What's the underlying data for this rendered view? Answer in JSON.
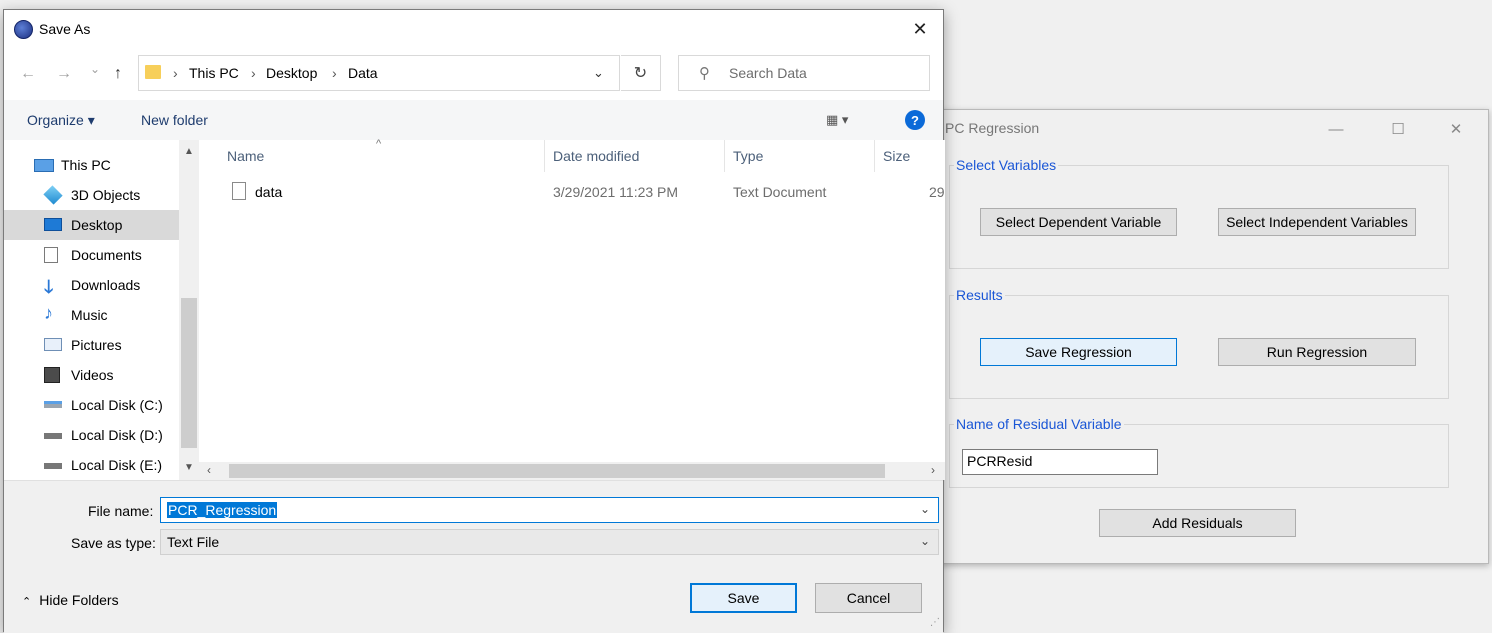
{
  "pcr_window": {
    "title": "PC Regression",
    "controls": {
      "minimize": "—",
      "maximize": "☐",
      "close": "✕"
    },
    "groups": {
      "select_variables": {
        "label": "Select Variables",
        "dependent_button": "Select Dependent Variable",
        "independent_button": "Select Independent Variables"
      },
      "results": {
        "label": "Results",
        "save_button": "Save Regression",
        "run_button": "Run Regression"
      },
      "residual": {
        "label": "Name of Residual Variable",
        "value": "PCRResid"
      }
    },
    "add_residuals_button": "Add Residuals"
  },
  "dialog": {
    "title": "Save As",
    "close": "✕",
    "nav": {
      "back": "←",
      "forward": "→",
      "recent": "⌄",
      "up": "↑"
    },
    "breadcrumb": [
      "This PC",
      "Desktop",
      "Data"
    ],
    "breadcrumb_sep": "›",
    "address_dropdown": "⌄",
    "refresh": "↻",
    "search_placeholder": "Search Data",
    "search_icon": "⚲",
    "commands": {
      "organize": "Organize ▾",
      "new_folder": "New folder",
      "view": "▦ ▾",
      "help": "?"
    },
    "nav_pane": [
      {
        "label": "This PC",
        "icon": "computer-icon"
      },
      {
        "label": "3D Objects",
        "icon": "cube-icon"
      },
      {
        "label": "Desktop",
        "icon": "desktop-icon",
        "selected": true
      },
      {
        "label": "Documents",
        "icon": "documents-icon"
      },
      {
        "label": "Downloads",
        "icon": "download-icon"
      },
      {
        "label": "Music",
        "icon": "music-icon"
      },
      {
        "label": "Pictures",
        "icon": "pictures-icon"
      },
      {
        "label": "Videos",
        "icon": "videos-icon"
      },
      {
        "label": "Local Disk (C:)",
        "icon": "drive-icon"
      },
      {
        "label": "Local Disk (D:)",
        "icon": "drive-icon"
      },
      {
        "label": "Local Disk (E:)",
        "icon": "drive-icon"
      }
    ],
    "columns": {
      "name": "Name",
      "date": "Date modified",
      "type": "Type",
      "size": "Size"
    },
    "files": [
      {
        "name": "data",
        "date": "3/29/2021 11:23 PM",
        "type": "Text Document",
        "size": "29"
      }
    ],
    "file_name_label": "File name:",
    "file_name_value": "PCR_Regression",
    "save_type_label": "Save as type:",
    "save_type_value": "Text File",
    "save_button": "Save",
    "cancel_button": "Cancel",
    "hide_folders": "Hide Folders",
    "hide_folders_icon": "⌃"
  },
  "colors": {
    "accent": "#0078d7",
    "group_label": "#1a56d6",
    "selection": "#0078d7"
  }
}
